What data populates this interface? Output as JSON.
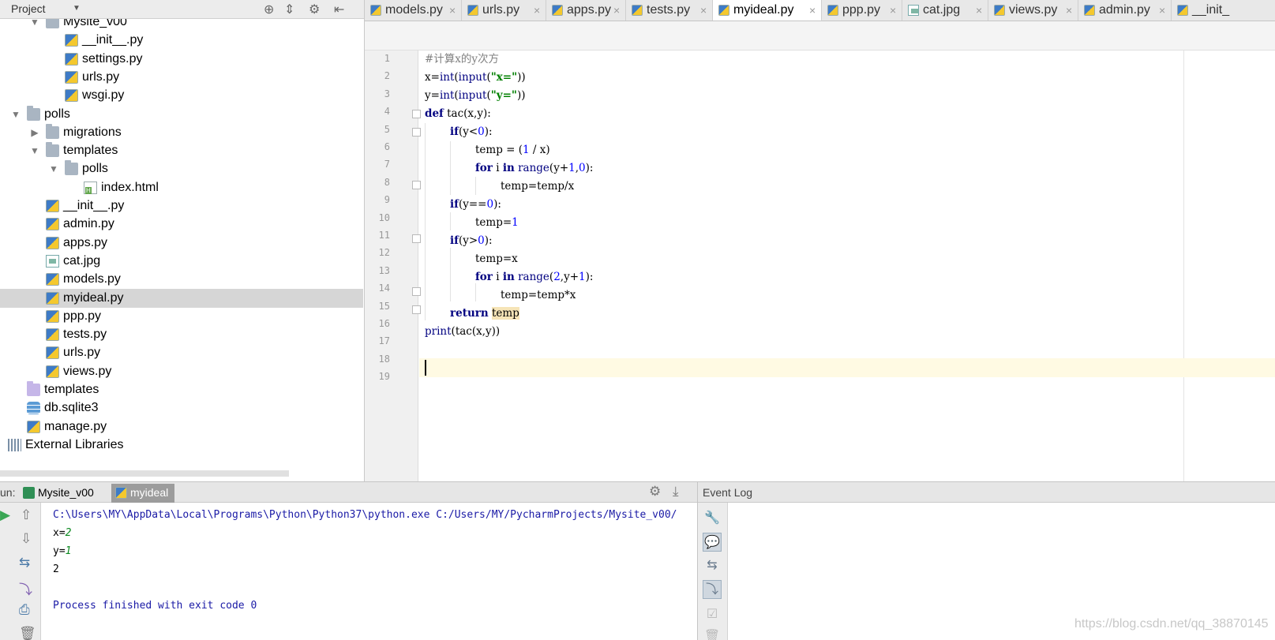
{
  "project_panel": {
    "title": "Project",
    "header_icons": [
      "target-icon",
      "collapse-icon",
      "gear-icon",
      "hide-icon"
    ],
    "tree": [
      {
        "label": "Mysite_v00",
        "type": "folder",
        "depth": 1,
        "expanded": true
      },
      {
        "label": "__init__.py",
        "type": "py",
        "depth": 2
      },
      {
        "label": "settings.py",
        "type": "py",
        "depth": 2
      },
      {
        "label": "urls.py",
        "type": "py",
        "depth": 2
      },
      {
        "label": "wsgi.py",
        "type": "py",
        "depth": 2
      },
      {
        "label": "polls",
        "type": "folder",
        "depth": 0,
        "expanded": true
      },
      {
        "label": "migrations",
        "type": "folder",
        "depth": 1,
        "expanded": false
      },
      {
        "label": "templates",
        "type": "folder",
        "depth": 1,
        "expanded": true
      },
      {
        "label": "polls",
        "type": "folder",
        "depth": 2,
        "expanded": true
      },
      {
        "label": "index.html",
        "type": "html",
        "depth": 3
      },
      {
        "label": "__init__.py",
        "type": "py",
        "depth": 1
      },
      {
        "label": "admin.py",
        "type": "py",
        "depth": 1
      },
      {
        "label": "apps.py",
        "type": "py",
        "depth": 1
      },
      {
        "label": "cat.jpg",
        "type": "image",
        "depth": 1
      },
      {
        "label": "models.py",
        "type": "py",
        "depth": 1
      },
      {
        "label": "myideal.py",
        "type": "py",
        "depth": 1,
        "selected": true
      },
      {
        "label": "ppp.py",
        "type": "py",
        "depth": 1
      },
      {
        "label": "tests.py",
        "type": "py",
        "depth": 1
      },
      {
        "label": "urls.py",
        "type": "py",
        "depth": 1
      },
      {
        "label": "views.py",
        "type": "py",
        "depth": 1
      },
      {
        "label": "templates",
        "type": "folder-purple",
        "depth": 0
      },
      {
        "label": "db.sqlite3",
        "type": "db",
        "depth": 0
      },
      {
        "label": "manage.py",
        "type": "py",
        "depth": 0
      },
      {
        "label": "External Libraries",
        "type": "lib",
        "depth": -1
      }
    ]
  },
  "editor_tabs": [
    {
      "label": "models.py",
      "icon": "python-file-icon"
    },
    {
      "label": "urls.py",
      "icon": "python-file-icon"
    },
    {
      "label": "apps.py",
      "icon": "python-file-icon"
    },
    {
      "label": "tests.py",
      "icon": "python-file-icon"
    },
    {
      "label": "myideal.py",
      "icon": "python-file-icon",
      "active": true
    },
    {
      "label": "ppp.py",
      "icon": "python-file-icon"
    },
    {
      "label": "cat.jpg",
      "icon": "image-file-icon"
    },
    {
      "label": "views.py",
      "icon": "python-file-icon"
    },
    {
      "label": "admin.py",
      "icon": "python-file-icon"
    },
    {
      "label": "__init_",
      "icon": "python-file-icon"
    }
  ],
  "editor": {
    "line_numbers": [
      "1",
      "2",
      "3",
      "4",
      "5",
      "6",
      "7",
      "8",
      "9",
      "10",
      "11",
      "12",
      "13",
      "14",
      "15",
      "16",
      "17",
      "18",
      "19"
    ],
    "current_line": "18",
    "code": {
      "l1": "#计算x的y次方",
      "l2_a": "x=",
      "l2_b": "int",
      "l2_c": "(",
      "l2_d": "input",
      "l2_e": "(",
      "l2_f": "\"x=\"",
      "l2_g": "))",
      "l3_a": "y=",
      "l3_b": "int",
      "l3_c": "(",
      "l3_d": "input",
      "l3_e": "(",
      "l3_f": "\"y=\"",
      "l3_g": "))",
      "l4_a": "def",
      "l4_b": " tac(x,y):",
      "l5_a": "if",
      "l5_b": "(y<",
      "l5_c": "0",
      "l5_d": "):",
      "l6_a": "temp = (",
      "l6_b": "1",
      "l6_c": " / x)",
      "l7_a": "for",
      "l7_b": " i ",
      "l7_c": "in",
      "l7_d": " ",
      "l7_e": "range",
      "l7_f": "(y+",
      "l7_g": "1",
      "l7_h": ",",
      "l7_i": "0",
      "l7_j": "):",
      "l8": "temp=temp/x",
      "l9_a": "if",
      "l9_b": "(y==",
      "l9_c": "0",
      "l9_d": "):",
      "l10_a": "temp=",
      "l10_b": "1",
      "l11_a": "if",
      "l11_b": "(y>",
      "l11_c": "0",
      "l11_d": "):",
      "l12": "temp=x",
      "l13_a": "for",
      "l13_b": " i ",
      "l13_c": "in",
      "l13_d": " ",
      "l13_e": "range",
      "l13_f": "(",
      "l13_g": "2",
      "l13_h": ",y+",
      "l13_i": "1",
      "l13_j": "):",
      "l14": "temp=temp*x",
      "l15_a": "return",
      "l15_b": " ",
      "l15_c": "temp",
      "l16_a": "print",
      "l16_b": "(tac(x,y))"
    }
  },
  "run_panel": {
    "label": "un:",
    "tabs": [
      {
        "label": "Mysite_v00",
        "icon": "django-icon"
      },
      {
        "label": "myideal",
        "icon": "python-file-icon",
        "active": true
      }
    ],
    "console": {
      "command": "C:\\Users\\MY\\AppData\\Local\\Programs\\Python\\Python37\\python.exe C:/Users/MY/PycharmProjects/Mysite_v00/",
      "prompt_x": "x=",
      "input_x": "2",
      "prompt_y": "y=",
      "input_y": "1",
      "result": "2",
      "finished": "Process finished with exit code 0"
    }
  },
  "event_log": {
    "title": "Event Log"
  },
  "watermark": "https://blog.csdn.net/qq_38870145"
}
